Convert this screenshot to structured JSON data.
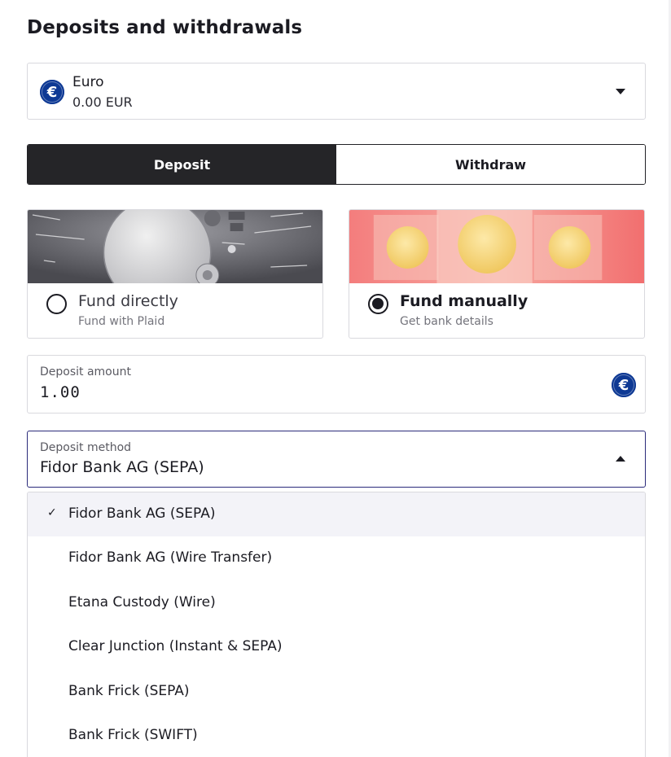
{
  "page": {
    "title": "Deposits and withdrawals"
  },
  "currency": {
    "icon": "euro-icon",
    "icon_glyph": "€",
    "name": "Euro",
    "balance": "0.00 EUR"
  },
  "tabs": [
    {
      "label": "Deposit",
      "active": true
    },
    {
      "label": "Withdraw",
      "active": false
    }
  ],
  "fund_options": [
    {
      "title": "Fund directly",
      "subtitle": "Fund with Plaid",
      "selected": false
    },
    {
      "title": "Fund manually",
      "subtitle": "Get bank details",
      "selected": true
    }
  ],
  "amount": {
    "label": "Deposit amount",
    "value": "1.00",
    "currency_glyph": "€"
  },
  "method": {
    "label": "Deposit method",
    "value": "Fidor Bank AG (SEPA)",
    "expanded": true,
    "check_glyph": "✓",
    "options": [
      {
        "label": "Fidor Bank AG (SEPA)",
        "selected": true
      },
      {
        "label": "Fidor Bank AG (Wire Transfer)",
        "selected": false
      },
      {
        "label": "Etana Custody (Wire)",
        "selected": false
      },
      {
        "label": "Clear Junction (Instant & SEPA)",
        "selected": false
      },
      {
        "label": "Bank Frick (SEPA)",
        "selected": false
      },
      {
        "label": "Bank Frick (SWIFT)",
        "selected": false
      }
    ]
  },
  "colors": {
    "accent_navy": "#0e3994",
    "dark": "#252528",
    "selected_row": "#f3f3f8"
  }
}
